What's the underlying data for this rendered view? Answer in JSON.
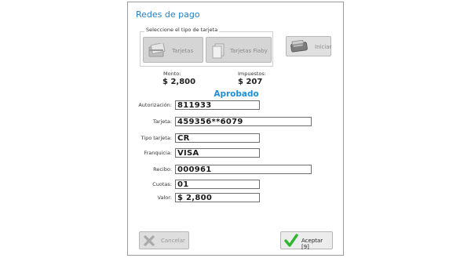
{
  "dialog": {
    "title": "Redes de pago"
  },
  "card_type_group": {
    "label": "Seleccione el tipo de tarjeta",
    "buttons": [
      {
        "label": "Tarjetas",
        "icon": "credit-card-icon"
      },
      {
        "label": "Tarjetas Fiaby",
        "icon": "cards-stack-icon"
      }
    ]
  },
  "start_button": {
    "label": "Iniciar",
    "icon": "card-reader-icon"
  },
  "amounts": {
    "monto_label": "Monto:",
    "monto_value": "$ 2,800",
    "impuestos_label": "Impuestos:",
    "impuestos_value": "$ 207"
  },
  "status": "Aprobado",
  "form": {
    "autorizacion": {
      "label": "Autorización:",
      "value": "811933"
    },
    "tarjeta": {
      "label": "Tarjeta:",
      "value": "459356**6079"
    },
    "tipo_tarjeta": {
      "label": "Tipo tarjeta:",
      "value": "CR"
    },
    "franquicia": {
      "label": "Franquicia:",
      "value": "VISA"
    },
    "recibo": {
      "label": "Recibo:",
      "value": "000961"
    },
    "cuotas": {
      "label": "Cuotas:",
      "value": "01"
    },
    "valor": {
      "label": "Valor:",
      "value": "$ 2,800"
    }
  },
  "footer": {
    "cancel_label": "Cancelar",
    "accept_label": "Aceptar [9]"
  },
  "colors": {
    "title": "#1f7fc4",
    "status": "#1f8fd6",
    "accept_check": "#2fb52f"
  }
}
